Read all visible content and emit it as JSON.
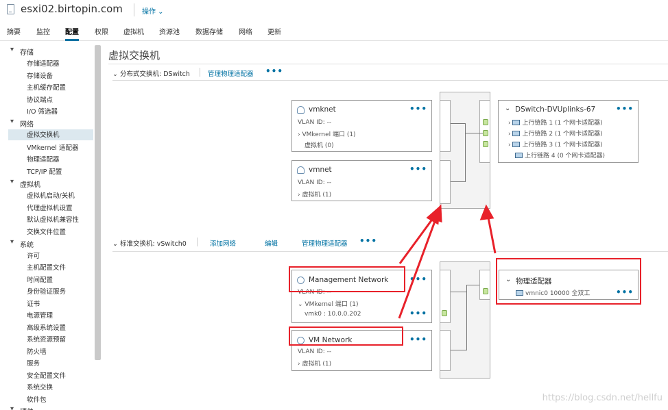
{
  "header": {
    "host": "esxi02.birtopin.com",
    "actions_label": "操作 ⌄"
  },
  "tabs": [
    "摘要",
    "监控",
    "配置",
    "权限",
    "虚拟机",
    "资源池",
    "数据存储",
    "网络",
    "更新"
  ],
  "sidebar": {
    "groups": [
      {
        "label": "存储",
        "items": [
          "存储适配器",
          "存储设备",
          "主机缓存配置",
          "协议端点",
          "I/O 筛选器"
        ]
      },
      {
        "label": "网络",
        "items": [
          "虚拟交换机",
          "VMkernel 适配器",
          "物理适配器",
          "TCP/IP 配置"
        ]
      },
      {
        "label": "虚拟机",
        "items": [
          "虚拟机启动/关机",
          "代理虚拟机设置",
          "默认虚拟机兼容性",
          "交换文件位置"
        ]
      },
      {
        "label": "系统",
        "items": [
          "许可",
          "主机配置文件",
          "时间配置",
          "身份验证服务",
          "证书",
          "电源管理",
          "高级系统设置",
          "系统资源预留",
          "防火墙",
          "服务",
          "安全配置文件",
          "系统交换",
          "软件包"
        ]
      },
      {
        "label": "硬件",
        "items": []
      }
    ],
    "selected": "虚拟交换机"
  },
  "main": {
    "title": "虚拟交换机",
    "dswitch": {
      "heading": "分布式交换机: DSwitch",
      "manage_link": "管理物理适配器",
      "portgroups": [
        {
          "name": "vmknet",
          "vlan": "VLAN ID: --",
          "line1": "VMkernel 端口 (1)",
          "line2": "虚拟机 (0)"
        },
        {
          "name": "vmnet",
          "vlan": "VLAN ID: --",
          "line1": "虚拟机 (1)"
        }
      ],
      "uplinks": {
        "name": "DSwitch-DVUplinks-67",
        "items": [
          "上行链路 1 (1 个网卡适配器)",
          "上行链路 2 (1 个网卡适配器)",
          "上行链路 3 (1 个网卡适配器)",
          "上行链路 4 (0 个网卡适配器)"
        ]
      }
    },
    "vswitch": {
      "heading": "标准交换机: vSwitch0",
      "add_network": "添加网络",
      "edit": "编辑",
      "manage_link": "管理物理适配器",
      "portgroups": [
        {
          "name": "Management Network",
          "vlan": "VLAN ID: --",
          "line1": "VMkernel 端口 (1)",
          "line2": "vmk0 : 10.0.0.202"
        },
        {
          "name": "VM Network",
          "vlan": "VLAN ID: --",
          "line1": "虚拟机 (1)"
        }
      ],
      "physical": {
        "title": "物理适配器",
        "nic": "vmnic0 10000 全双工"
      }
    }
  },
  "more_label": "•••",
  "watermark": "https://blog.csdn.net/hellfu",
  "colors": {
    "accent": "#0072a3",
    "annotation_red": "#e8212a",
    "port_green": "#c8e6a0"
  }
}
